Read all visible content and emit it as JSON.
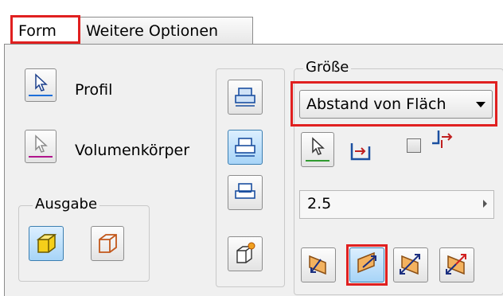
{
  "tabs": [
    {
      "label": "Form",
      "active": true
    },
    {
      "label": "Weitere Optionen",
      "active": false
    }
  ],
  "profile_label": "Profil",
  "solid_label": "Volumenkörper",
  "output": {
    "label": "Ausgabe"
  },
  "size": {
    "label": "Größe",
    "extent_selected": "Abstand von Fläch",
    "distance_value": "2.5"
  },
  "colors": {
    "highlight": "#e02020",
    "active_button": "#a7d4f7",
    "profile_underline": "#1e6fd9",
    "solid_underline": "#b0148c"
  },
  "icons": [
    "cursor-icon",
    "solid-cursor-icon",
    "solid-output-icon",
    "surface-output-icon",
    "join-icon",
    "cut-icon",
    "intersect-icon",
    "new-solid-icon",
    "select-face-icon",
    "distance-measure-icon",
    "offset-icon",
    "direction-1-icon",
    "direction-2-icon",
    "symmetric-icon",
    "asymmetric-icon"
  ]
}
